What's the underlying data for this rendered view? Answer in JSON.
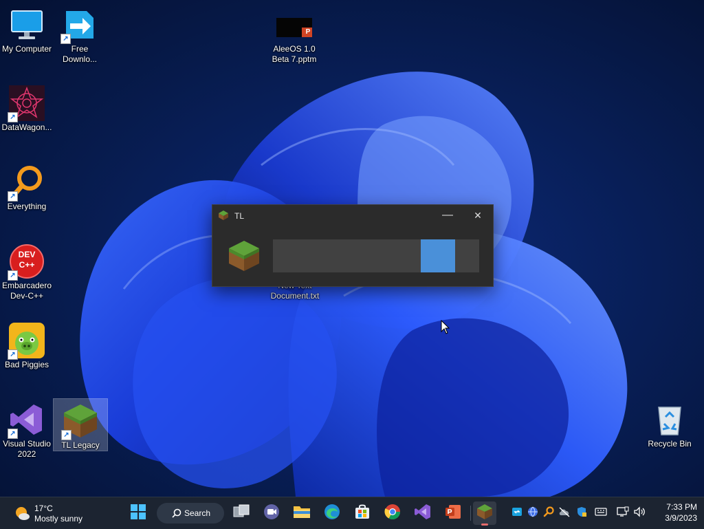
{
  "desktop": {
    "icons": [
      {
        "label": "My Computer"
      },
      {
        "label": "Free Downlo..."
      },
      {
        "label": "AleeOS 1.0 Beta 7.pptm"
      },
      {
        "label": "DataWagon..."
      },
      {
        "label": "Everything"
      },
      {
        "label": "Embarcadero Dev-C++"
      },
      {
        "label": "Bad Piggies"
      },
      {
        "label": "Visual Studio 2022"
      },
      {
        "label": "TL Legacy"
      },
      {
        "label": "New Text Document.txt"
      },
      {
        "label": "Recycle Bin"
      }
    ],
    "devcpp_badge": "DEV C++",
    "pptm_badge": "P"
  },
  "dialog": {
    "title": "TL",
    "minimize_glyph": "—",
    "close_glyph": "✕",
    "progress_start": 0.717,
    "progress_end": 0.883
  },
  "taskbar": {
    "weather_temp": "17°C",
    "weather_desc": "Mostly sunny",
    "search_label": "Search",
    "clock_time": "7:33 PM",
    "clock_date": "3/9/2023"
  },
  "colors": {
    "accent": "#4a90d9",
    "taskbar_bg": "#1c2431",
    "dialog_bg": "#2b2b2b"
  }
}
